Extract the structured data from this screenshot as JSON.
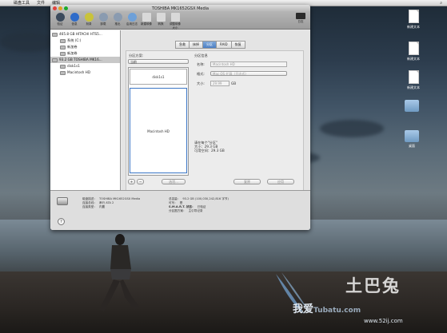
{
  "menubar": {
    "apple": "",
    "items": [
      "磁盘工具",
      "文件",
      "编辑"
    ],
    "right_items": [
      "⌕"
    ]
  },
  "desktop_icons": [
    {
      "label": "新建文本",
      "kind": "document"
    },
    {
      "label": "新建文本",
      "kind": "document"
    },
    {
      "label": "新建文本",
      "kind": "document"
    },
    {
      "label": "",
      "kind": "folder"
    },
    {
      "label": "桌面",
      "kind": "folder"
    }
  ],
  "window": {
    "title": "TOSHIBA MK1652GSX Media",
    "toolbar": {
      "buttons": [
        {
          "label": "验证",
          "icon": "microscope-icon",
          "color": "#3b4a5c"
        },
        {
          "label": "信息",
          "icon": "info-icon",
          "color": "#2f6cc9"
        },
        {
          "label": "刻录",
          "icon": "burn-icon",
          "color": "#c9c33a"
        },
        {
          "label": "卸载",
          "icon": "eject-icon",
          "color": "#8a9bb0"
        },
        {
          "label": "推出",
          "icon": "eject2-icon",
          "color": "#8a9bb0"
        },
        {
          "label": "启用日志",
          "icon": "journal-icon",
          "color": "#6ea0d8"
        },
        {
          "label": "新建映像",
          "icon": "new-image-icon",
          "color": "#d9d9d9"
        },
        {
          "label": "转换",
          "icon": "convert-icon",
          "color": "#d9d9d9"
        },
        {
          "label": "调整映像大小",
          "icon": "resize-icon",
          "color": "#d9d9d9"
        }
      ],
      "log_label": "日志"
    },
    "sidebar": {
      "items": [
        {
          "label": "465.8 GB HITACHI HTS5...",
          "indent": 0,
          "selected": false
        },
        {
          "label": "系统 (C:)",
          "indent": 1,
          "selected": false
        },
        {
          "label": "新加卷",
          "indent": 1,
          "selected": false
        },
        {
          "label": "新加卷",
          "indent": 1,
          "selected": false
        },
        {
          "label": "93.2 GB TOSHIBA MK16...",
          "indent": 0,
          "selected": true
        },
        {
          "label": "disk1s1",
          "indent": 1,
          "selected": false
        },
        {
          "label": "Macintosh HD",
          "indent": 1,
          "selected": false
        }
      ]
    },
    "tabs": [
      {
        "label": "急救",
        "active": false
      },
      {
        "label": "抹掉",
        "active": false
      },
      {
        "label": "分区",
        "active": true
      },
      {
        "label": "RAID",
        "active": false
      },
      {
        "label": "恢复",
        "active": false
      }
    ],
    "partition": {
      "layout_label": "分区方案:",
      "layout_value": "当前",
      "info_label": "分区信息",
      "name_label": "名称:",
      "name_value": "Macintosh HD",
      "format_label": "格式:",
      "format_value": "Mac OS 扩展（日志式）",
      "size_label": "大小:",
      "size_value": "29.99",
      "size_unit": "GB",
      "partitions": [
        "disk1s1",
        "Macintosh HD"
      ],
      "add_label": "+",
      "remove_label": "−",
      "options_label": "选项...",
      "description": "要抹掉并分区所选磁盘，请从\"分区方案\"弹出式菜单中选取一个布局，为每个分区设定选项，然后点按\"应用\"。",
      "status_line1": "请在每个\"分区\"",
      "status_line2": "大小：29.3 GB",
      "status_line3": "可用空间：29.3 GB",
      "revert_label": "复原",
      "apply_label": "应用"
    },
    "bottom": {
      "left": [
        {
          "k": "磁盘描述：",
          "v": "TOSHIBA MK1652GSX Media"
        },
        {
          "k": "连接总线：",
          "v": "串行 ATA 2"
        },
        {
          "k": "连接类型：",
          "v": "内置"
        }
      ],
      "right": [
        {
          "k": "总容量：",
          "v": "93.2 GB (100,030,242,816 字节)"
        },
        {
          "k": "可写：",
          "v": "是"
        },
        {
          "k": "S.M.A.R.T. 状态：",
          "v": "已验证"
        },
        {
          "k": "分区图方案：",
          "v": "主引导记录"
        }
      ],
      "help": "?"
    }
  },
  "watermark": {
    "logo": "土巴兔",
    "site_a": "我爱",
    "site_b": "Tubatu.com",
    "url": "www.52ij.com"
  }
}
